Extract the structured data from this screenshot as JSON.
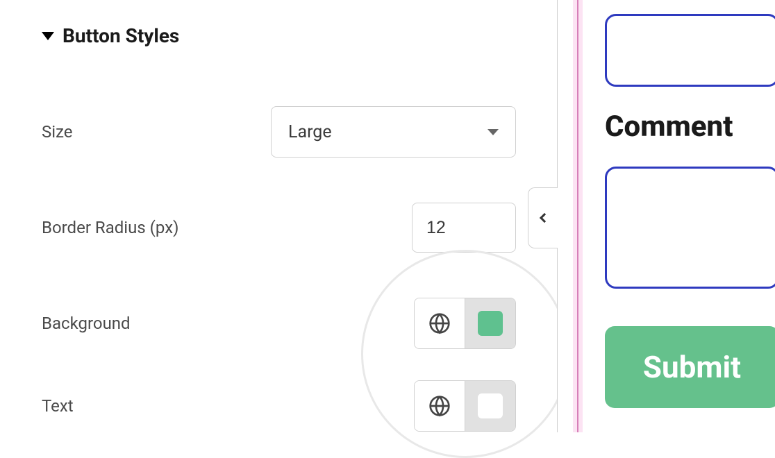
{
  "section": {
    "title": "Button Styles"
  },
  "fields": {
    "size": {
      "label": "Size",
      "value": "Large"
    },
    "radius": {
      "label": "Border Radius (px)",
      "value": "12"
    },
    "background": {
      "label": "Background",
      "swatch": "#5fc18f"
    },
    "text": {
      "label": "Text",
      "swatch": "#ffffff"
    }
  },
  "preview": {
    "comment_label": "Comment",
    "submit_label": "Submit"
  }
}
